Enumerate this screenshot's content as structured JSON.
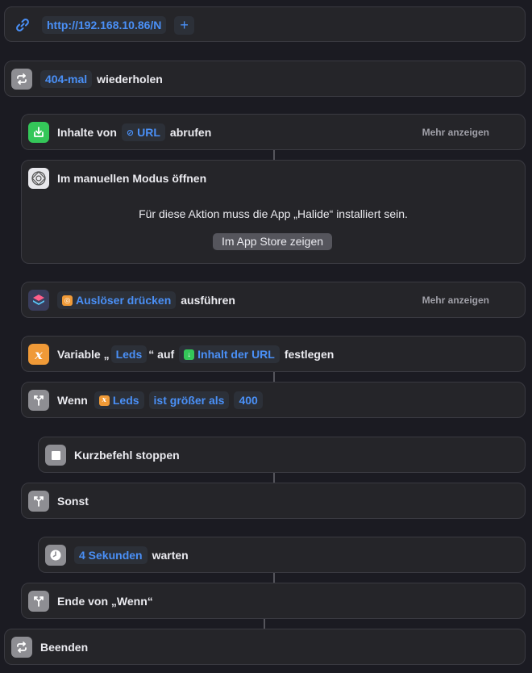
{
  "url_block": {
    "url": "http://192.168.10.86/N",
    "add_symbol": "+"
  },
  "repeat_block": {
    "count": "404-mal",
    "verb": "wiederholen"
  },
  "get_contents": {
    "prefix": "Inhalte von",
    "token": "URL",
    "verb": "abrufen",
    "more": "Mehr anzeigen"
  },
  "manual_mode": {
    "title": "Im manuellen Modus öffnen",
    "notice": "Für diese Aktion muss die App „Halide“ installiert sein.",
    "store_button": "Im App Store zeigen"
  },
  "run_shortcut": {
    "token": "Auslöser drücken",
    "verb": "ausführen",
    "more": "Mehr anzeigen"
  },
  "set_variable": {
    "prefix": "Variable „",
    "var_name": "Leds",
    "mid": "“ auf",
    "value_token": "Inhalt der URL",
    "verb": "festlegen",
    "x_glyph": "x"
  },
  "if_block": {
    "label": "Wenn",
    "var_token": "Leds",
    "condition": "ist größer als",
    "value": "400"
  },
  "stop_block": {
    "label": "Kurzbefehl stoppen"
  },
  "else_block": {
    "label": "Sonst"
  },
  "wait_block": {
    "token": "4 Sekunden",
    "verb": "warten"
  },
  "end_if": {
    "label": "Ende von „Wenn“"
  },
  "end_repeat": {
    "label": "Beenden"
  },
  "colors": {
    "background": "#1b1b22",
    "card": "#252529",
    "accent_blue": "#4a90f7",
    "green": "#34c759",
    "orange": "#f09a37",
    "gray_icon": "#8e8e93"
  }
}
